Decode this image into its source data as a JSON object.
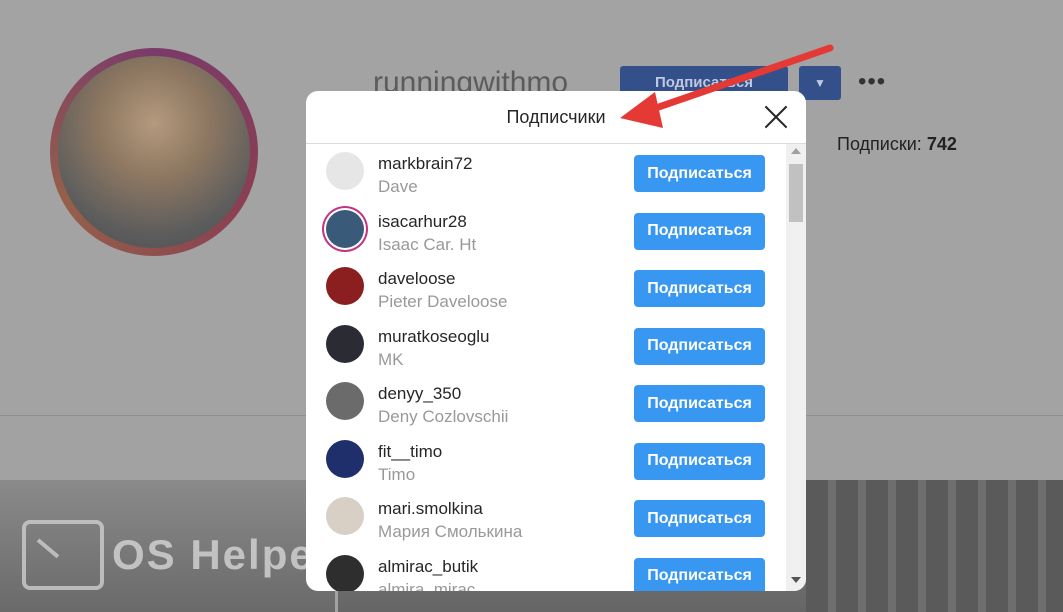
{
  "background": {
    "username": "runningwithmo",
    "follow_label": "Подписаться",
    "more_label": "•••",
    "subscriptions_label": "Подписки:",
    "subscriptions_count": "742"
  },
  "watermark": {
    "text": "OS Helper"
  },
  "modal": {
    "title": "Подписчики",
    "follow_label": "Подписаться",
    "rows": [
      {
        "username": "markbrain72",
        "full_name": "Dave",
        "avatar_color": "#e6e6e6",
        "ring": false
      },
      {
        "username": "isacarhur28",
        "full_name": "Isaac Car. Ht",
        "avatar_color": "#3a5a7a",
        "ring": true
      },
      {
        "username": "daveloose",
        "full_name": "Pieter Daveloose",
        "avatar_color": "#8b1e1e",
        "ring": false
      },
      {
        "username": "muratkoseoglu",
        "full_name": "MK",
        "avatar_color": "#2b2b34",
        "ring": false
      },
      {
        "username": "denyy_350",
        "full_name": "Deny Cozlovschii",
        "avatar_color": "#6b6b6b",
        "ring": false
      },
      {
        "username": "fit__timo",
        "full_name": "Timo",
        "avatar_color": "#1e2f6b",
        "ring": false
      },
      {
        "username": "mari.smolkina",
        "full_name": "Мария Смолькина",
        "avatar_color": "#d8cfc5",
        "ring": false
      },
      {
        "username": "almirac_butik",
        "full_name": "almira_mirac",
        "avatar_color": "#2e2e2e",
        "ring": false
      }
    ]
  },
  "colors": {
    "accent": "#3897f0",
    "annotation_arrow": "#e53935"
  }
}
